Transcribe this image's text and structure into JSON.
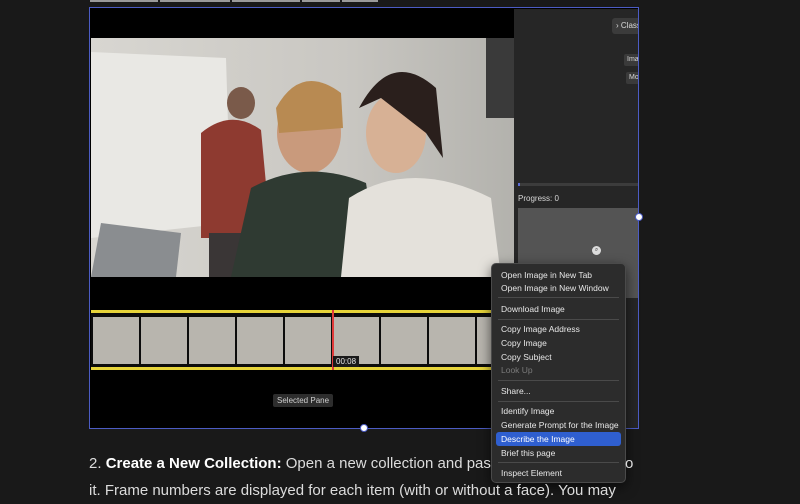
{
  "panel": {
    "classify_label": "Class",
    "image_label": "Ima",
    "mode_label": "Mo",
    "progress_text": "Progress: 0",
    "progress_value": 0
  },
  "video": {
    "timestamp": "00:08",
    "selected_pane_label": "Selected Pane"
  },
  "context_menu": {
    "items": [
      "Open Image in New Tab",
      "Open Image in New Window",
      "Download Image",
      "Copy Image Address",
      "Copy Image",
      "Copy Subject",
      "Look Up",
      "Share...",
      "Identify Image",
      "Generate Prompt for the Image",
      "Describe the Image",
      "Brief this page",
      "Inspect Element"
    ],
    "highlighted": "Describe the Image",
    "disabled": [
      "Look Up"
    ]
  },
  "article": {
    "step_number": "2.",
    "step_title": "Create a New Collection:",
    "line1_text": " Open a new collection and pas",
    "line1_tail": "o",
    "line2_text": "it. Frame numbers are displayed for each item (with or without a face). You may"
  },
  "colors": {
    "accent_border": "#4c5cc4",
    "filmstrip_border": "#e6d33a",
    "menu_highlight": "#2f5fd0",
    "playhead": "#e03a3a"
  }
}
